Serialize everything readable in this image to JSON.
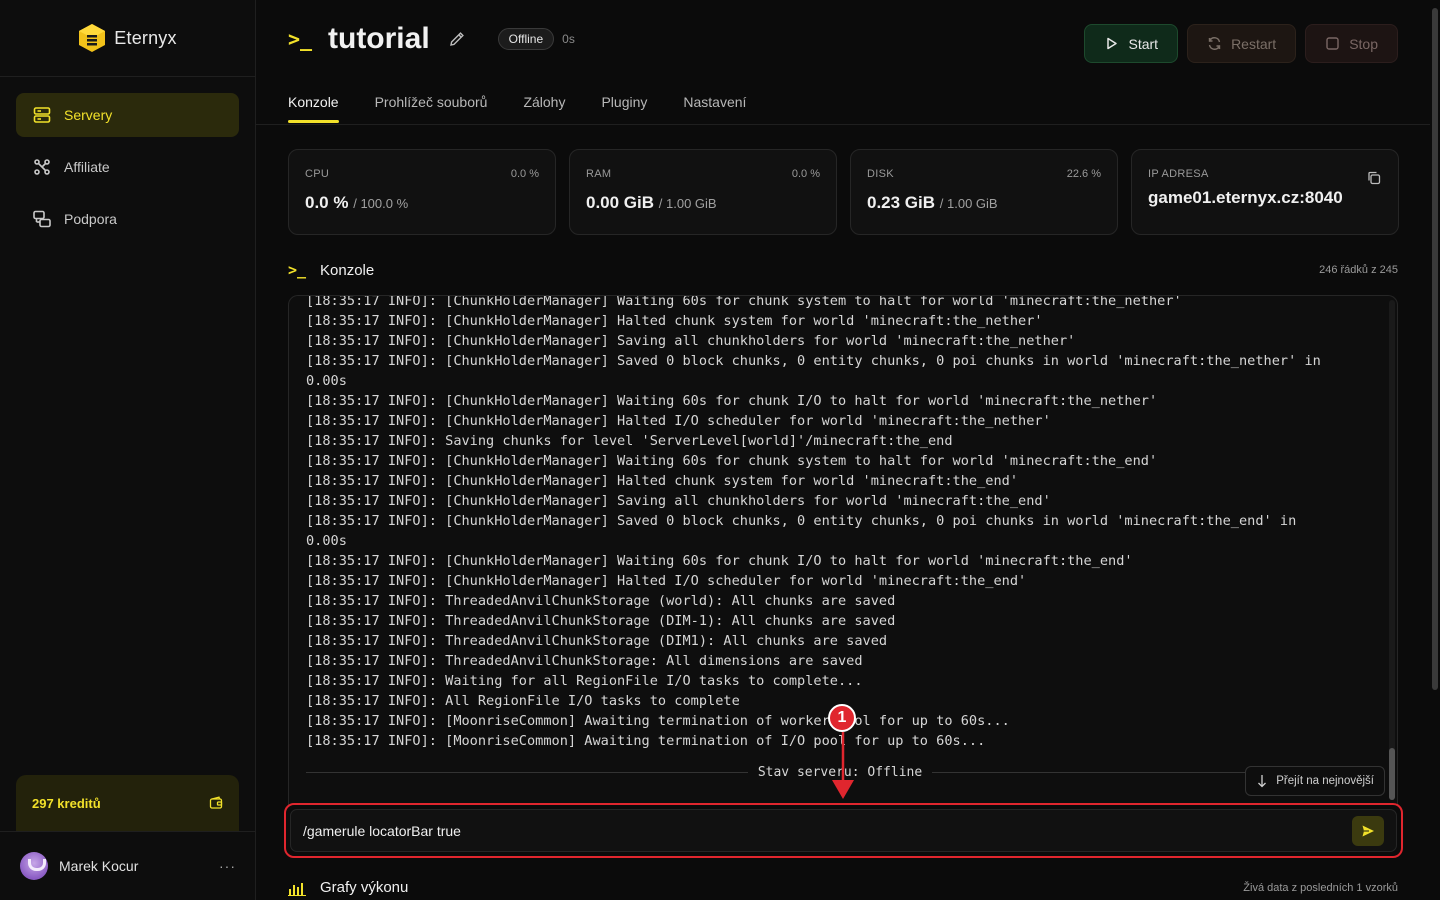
{
  "brand": {
    "name": "Eternyx"
  },
  "sidebar": {
    "items": [
      {
        "label": "Servery",
        "icon": "server-icon",
        "active": true
      },
      {
        "label": "Affiliate",
        "icon": "affiliate-icon",
        "active": false
      },
      {
        "label": "Podpora",
        "icon": "support-icon",
        "active": false
      }
    ],
    "credits": "297 kreditů",
    "user": {
      "name": "Marek Kocur",
      "menu": "···"
    }
  },
  "header": {
    "prompt": ">_",
    "title": "tutorial",
    "status": "Offline",
    "uptime": "0s",
    "buttons": {
      "start": "Start",
      "restart": "Restart",
      "stop": "Stop"
    }
  },
  "tabs": [
    "Konzole",
    "Prohlížeč souborů",
    "Zálohy",
    "Pluginy",
    "Nastavení"
  ],
  "stats": {
    "cpu": {
      "label": "CPU",
      "pct": "0.0 %",
      "value": "0.0 %",
      "limit": "/ 100.0 %"
    },
    "ram": {
      "label": "RAM",
      "pct": "0.0 %",
      "value": "0.00 GiB",
      "limit": "/ 1.00 GiB"
    },
    "disk": {
      "label": "DISK",
      "pct": "22.6 %",
      "value": "0.23 GiB",
      "limit": "/ 1.00 GiB"
    },
    "ip": {
      "label": "IP ADRESA",
      "value": "game01.eternyx.cz:8040"
    }
  },
  "console": {
    "prompt": ">_",
    "title": "Konzole",
    "meta": "246 řádků z 245",
    "lines": [
      "[18:35:17 INFO]: [ChunkHolderManager] Waiting 60s for chunk system to halt for world 'minecraft:the_nether'",
      "[18:35:17 INFO]: [ChunkHolderManager] Halted chunk system for world 'minecraft:the_nether'",
      "[18:35:17 INFO]: [ChunkHolderManager] Saving all chunkholders for world 'minecraft:the_nether'",
      "[18:35:17 INFO]: [ChunkHolderManager] Saved 0 block chunks, 0 entity chunks, 0 poi chunks in world 'minecraft:the_nether' in\n0.00s",
      "[18:35:17 INFO]: [ChunkHolderManager] Waiting 60s for chunk I/O to halt for world 'minecraft:the_nether'",
      "[18:35:17 INFO]: [ChunkHolderManager] Halted I/O scheduler for world 'minecraft:the_nether'",
      "[18:35:17 INFO]: Saving chunks for level 'ServerLevel[world]'/minecraft:the_end",
      "[18:35:17 INFO]: [ChunkHolderManager] Waiting 60s for chunk system to halt for world 'minecraft:the_end'",
      "[18:35:17 INFO]: [ChunkHolderManager] Halted chunk system for world 'minecraft:the_end'",
      "[18:35:17 INFO]: [ChunkHolderManager] Saving all chunkholders for world 'minecraft:the_end'",
      "[18:35:17 INFO]: [ChunkHolderManager] Saved 0 block chunks, 0 entity chunks, 0 poi chunks in world 'minecraft:the_end' in\n0.00s",
      "[18:35:17 INFO]: [ChunkHolderManager] Waiting 60s for chunk I/O to halt for world 'minecraft:the_end'",
      "[18:35:17 INFO]: [ChunkHolderManager] Halted I/O scheduler for world 'minecraft:the_end'",
      "[18:35:17 INFO]: ThreadedAnvilChunkStorage (world): All chunks are saved",
      "[18:35:17 INFO]: ThreadedAnvilChunkStorage (DIM-1): All chunks are saved",
      "[18:35:17 INFO]: ThreadedAnvilChunkStorage (DIM1): All chunks are saved",
      "[18:35:17 INFO]: ThreadedAnvilChunkStorage: All dimensions are saved",
      "[18:35:17 INFO]: Waiting for all RegionFile I/O tasks to complete...",
      "[18:35:17 INFO]: All RegionFile I/O tasks to complete",
      "[18:35:17 INFO]: [MoonriseCommon] Awaiting termination of worker pool for up to 60s...",
      "[18:35:17 INFO]: [MoonriseCommon] Awaiting termination of I/O pool for up to 60s..."
    ],
    "status_line": "Stav serveru: Offline",
    "jump_label": "Přejít na nejnovější",
    "input_value": "/gamerule locatorBar true"
  },
  "annotation": {
    "number": "1",
    "color": "#e0262e"
  },
  "performance": {
    "title": "Grafy výkonu",
    "meta": "Živá data z posledních 1 vzorků"
  },
  "colors": {
    "accent": "#f2e12a",
    "start": "#0f2a1a",
    "highlight": "#e0262e"
  }
}
